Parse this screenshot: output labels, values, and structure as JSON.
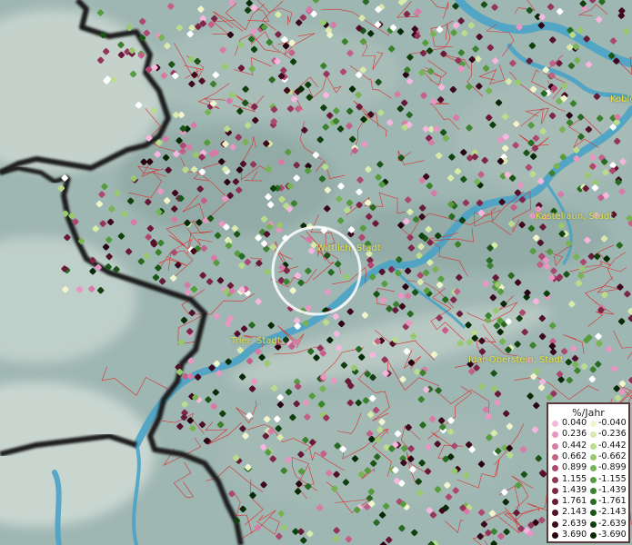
{
  "map": {
    "places": [
      {
        "name": "Koble"
      },
      {
        "name": "Wittlich, Stadt"
      },
      {
        "name": "Kastellaun, Stadt"
      },
      {
        "name": "Trier, Stadt"
      },
      {
        "name": "Idar-Oberstein, Stadt"
      }
    ]
  },
  "legend": {
    "title": "%/Jahr",
    "positive": [
      {
        "label": "0.040",
        "color": "#f6b6dd"
      },
      {
        "label": "0.236",
        "color": "#e896c2"
      },
      {
        "label": "0.442",
        "color": "#d87aa6"
      },
      {
        "label": "0.662",
        "color": "#c45f8a"
      },
      {
        "label": "0.899",
        "color": "#ad4870"
      },
      {
        "label": "1.155",
        "color": "#96355b"
      },
      {
        "label": "1.439",
        "color": "#7f2648"
      },
      {
        "label": "1.761",
        "color": "#681a38"
      },
      {
        "label": "2.143",
        "color": "#531129"
      },
      {
        "label": "2.639",
        "color": "#3f091d"
      },
      {
        "label": "3.690",
        "color": "#2a0412"
      }
    ],
    "negative": [
      {
        "label": "-0.040",
        "color": "#f0f5cc"
      },
      {
        "label": "-0.236",
        "color": "#d9ebac"
      },
      {
        "label": "-0.442",
        "color": "#bcdc8d"
      },
      {
        "label": "-0.662",
        "color": "#99c96e"
      },
      {
        "label": "-0.899",
        "color": "#77b354"
      },
      {
        "label": "-1.155",
        "color": "#579b3f"
      },
      {
        "label": "-1.439",
        "color": "#3c822e"
      },
      {
        "label": "-1.761",
        "color": "#286a21"
      },
      {
        "label": "-2.143",
        "color": "#1a5417"
      },
      {
        "label": "-2.639",
        "color": "#0f400e"
      },
      {
        "label": "-3.690",
        "color": "#062b06"
      }
    ]
  },
  "colors": {
    "terrain": "#9fb7b3",
    "terrain_light": "#c9d6d0",
    "river": "#4aa3c6",
    "border": "#1a1a1a",
    "admin": "#d73030",
    "highlight": "#ffffff"
  }
}
